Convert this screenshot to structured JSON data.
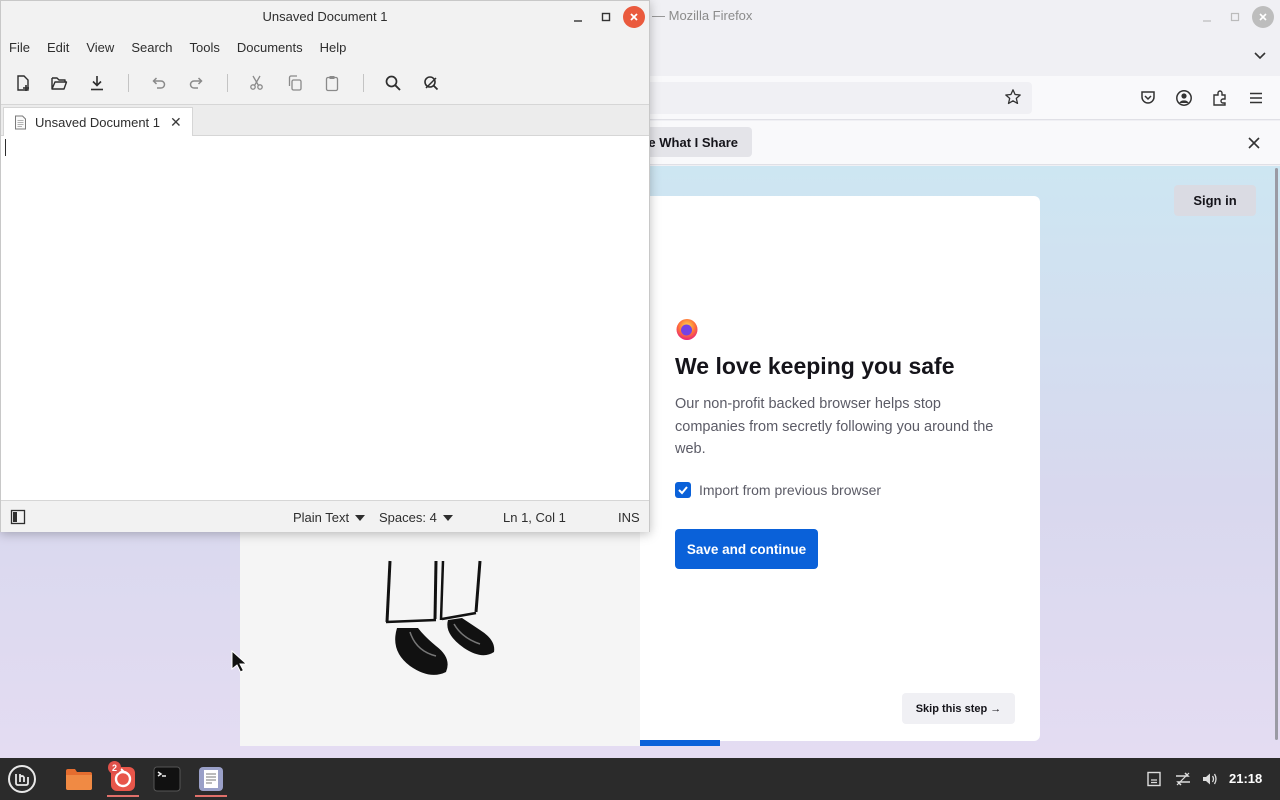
{
  "firefox": {
    "window_title": "— Mozilla Firefox",
    "notification_button": "e What I Share",
    "signin_label": "Sign in",
    "onboarding": {
      "title": "We love keeping you safe",
      "description": "Our non-profit backed browser helps stop companies from secretly following you around the web.",
      "import_checkbox_label": "Import from previous browser",
      "import_checked": true,
      "primary_button": "Save and continue",
      "skip_button": "Skip this step →",
      "progress": 0.2
    }
  },
  "editor": {
    "window_title": "Unsaved Document 1",
    "menu": [
      "File",
      "Edit",
      "View",
      "Search",
      "Tools",
      "Documents",
      "Help"
    ],
    "tab_label": "Unsaved Document 1",
    "tab_close": "✕",
    "status": {
      "language": "Plain Text",
      "spaces": "Spaces: 4",
      "position": "Ln 1, Col 1",
      "mode": "INS"
    }
  },
  "taskbar": {
    "clock": "21:18",
    "notification_count": "2"
  },
  "colors": {
    "accent_blue": "#0a61d9",
    "close_orange": "#ea5a3d",
    "taskbar_bg": "#2b2b2b"
  }
}
